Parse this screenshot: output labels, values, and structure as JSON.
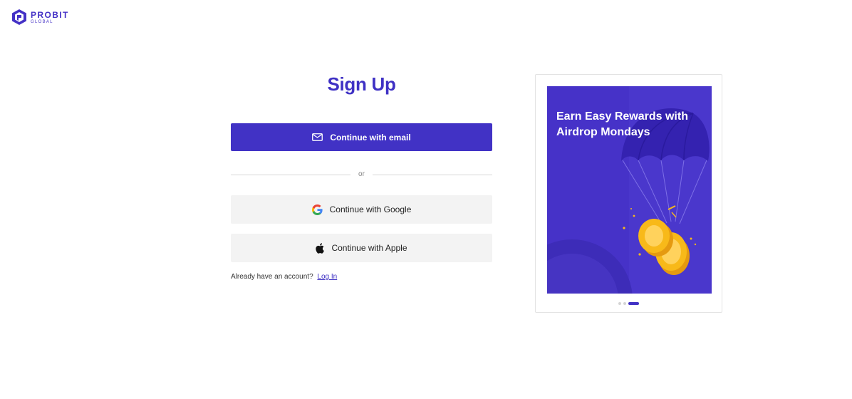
{
  "brand": {
    "name": "PROBIT",
    "sub": "GLOBAL",
    "accent": "#4132c5"
  },
  "signup": {
    "title": "Sign Up",
    "email_button": "Continue with email",
    "divider_text": "or",
    "google_button": "Continue with Google",
    "apple_button": "Continue with Apple",
    "login_prompt": "Already have an account?",
    "login_link": "Log In"
  },
  "promo": {
    "heading": "Earn Easy Rewards with Airdrop Mondays",
    "slide_count": 3,
    "active_slide": 3,
    "background_color": "#4632c8",
    "coin_color": "#f8b919"
  },
  "icons": {
    "logo": "probit-logo-icon",
    "email": "mail-icon",
    "google": "google-icon",
    "apple": "apple-icon"
  }
}
